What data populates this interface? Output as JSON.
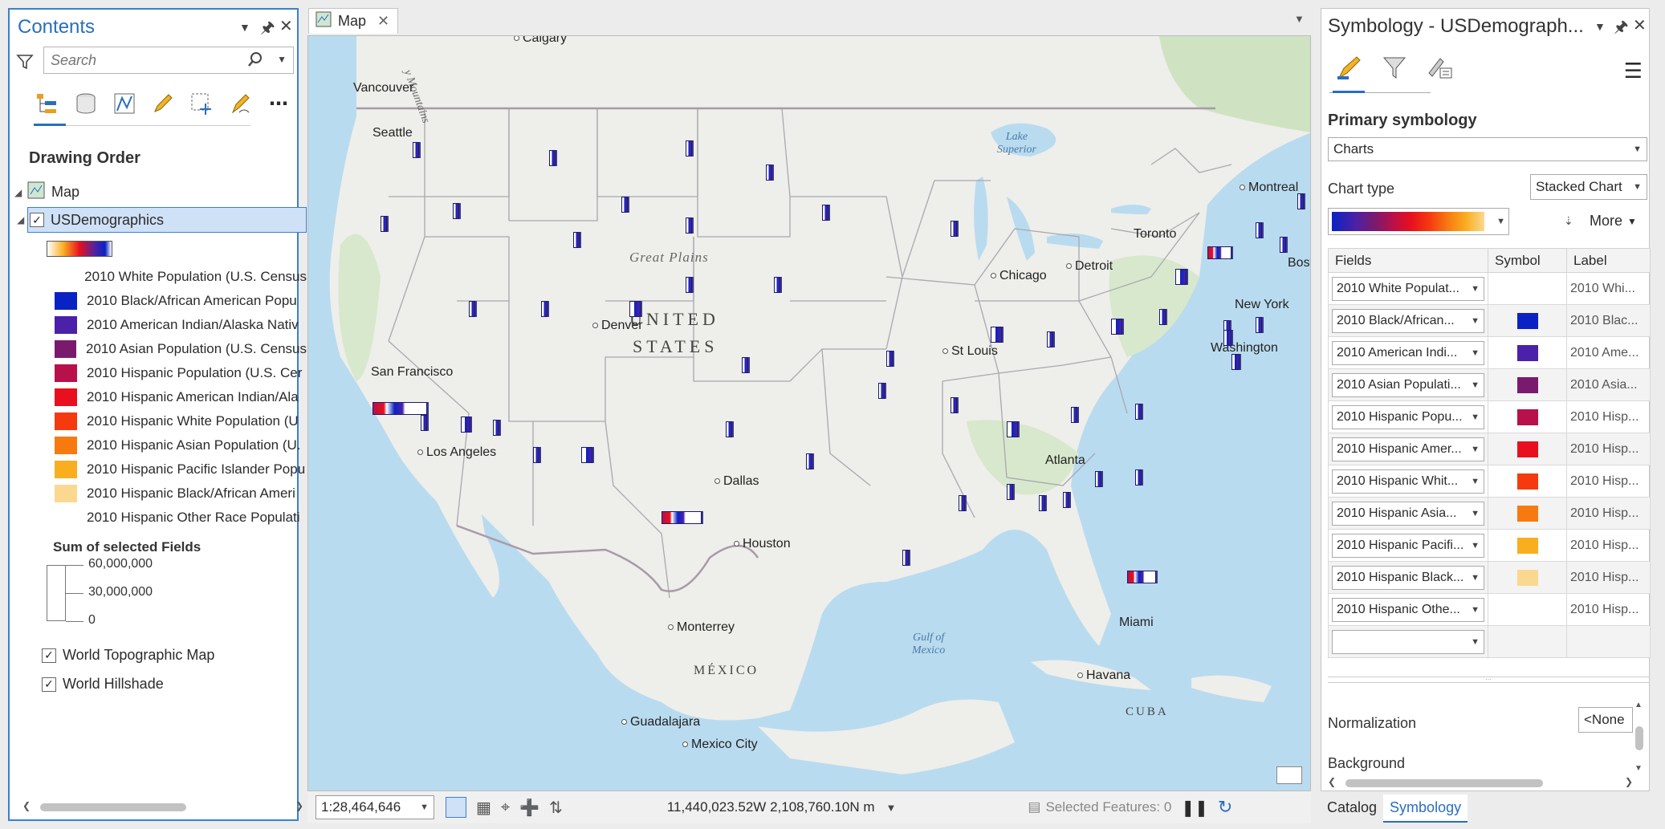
{
  "contents": {
    "title": "Contents",
    "search_placeholder": "Search",
    "drawing_order": "Drawing Order",
    "map_node": "Map",
    "layer_name": "USDemographics",
    "legend": [
      {
        "label": "2010 White Population (U.S. Census",
        "color": "#ffffff"
      },
      {
        "label": "2010 Black/African American Popu",
        "color": "#0a22c4"
      },
      {
        "label": "2010 American Indian/Alaska Nativ",
        "color": "#4a21a8"
      },
      {
        "label": "2010 Asian Population (U.S. Census",
        "color": "#7a1a6e"
      },
      {
        "label": "2010 Hispanic Population (U.S. Cer",
        "color": "#b8104a"
      },
      {
        "label": "2010 Hispanic American Indian/Ala",
        "color": "#e8101e"
      },
      {
        "label": "2010 Hispanic White Population (U",
        "color": "#f53a10"
      },
      {
        "label": "2010 Hispanic Asian Population (U.",
        "color": "#f77a10"
      },
      {
        "label": "2010 Hispanic Pacific Islander Popu",
        "color": "#f9ae20"
      },
      {
        "label": "2010 Hispanic Black/African Ameri",
        "color": "#fbd890"
      },
      {
        "label": "2010 Hispanic Other Race Populati",
        "color": "#ffffff"
      }
    ],
    "sum_title": "Sum of selected Fields",
    "sum_values": [
      "60,000,000",
      "30,000,000",
      "0"
    ],
    "basemaps": [
      "World Topographic Map",
      "World Hillshade"
    ]
  },
  "map": {
    "tab_label": "Map",
    "cities": [
      {
        "name": "Calgary"
      },
      {
        "name": "Vancouver"
      },
      {
        "name": "Seattle"
      },
      {
        "name": "San Francisco"
      },
      {
        "name": "Los Angeles"
      },
      {
        "name": "Denver"
      },
      {
        "name": "Dallas"
      },
      {
        "name": "Houston"
      },
      {
        "name": "Monterrey"
      },
      {
        "name": "Guadalajara"
      },
      {
        "name": "Mexico City"
      },
      {
        "name": "Chicago"
      },
      {
        "name": "St Louis"
      },
      {
        "name": "Detroit"
      },
      {
        "name": "Toronto"
      },
      {
        "name": "Montreal"
      },
      {
        "name": "New York"
      },
      {
        "name": "Washington"
      },
      {
        "name": "Atlanta"
      },
      {
        "name": "Miami"
      },
      {
        "name": "Havana"
      },
      {
        "name": "Bost"
      }
    ],
    "country_label_1": "UNITED",
    "country_label_2": "STATES",
    "mexico_label": "MÉXICO",
    "cuba_label": "CUBA",
    "great_plains": "Great Plains",
    "lake_superior": "Lake\nSuperior",
    "gulf": "Gulf of\nMexico",
    "mountains": "y Mountains",
    "scale": "1:28,464,646",
    "coordinates": "11,440,023.52W 2,108,760.10N m",
    "selected_features": "Selected Features: 0"
  },
  "symbology": {
    "title": "Symbology - USDemograph...",
    "primary": "Primary symbology",
    "renderer": "Charts",
    "chart_type_label": "Chart type",
    "chart_type": "Stacked Chart",
    "more": "More",
    "col_fields": "Fields",
    "col_symbol": "Symbol",
    "col_label": "Label",
    "rows": [
      {
        "field": "2010 White Populat...",
        "color": "",
        "label": "2010 Whi..."
      },
      {
        "field": "2010   Black/African...",
        "color": "#0a22c4",
        "label": "2010 Blac..."
      },
      {
        "field": "2010  American  Indi...",
        "color": "#4a21a8",
        "label": "2010 Ame..."
      },
      {
        "field": "2010 Asian Populati...",
        "color": "#7a1a6e",
        "label": "2010 Asia..."
      },
      {
        "field": "2010 Hispanic Popu...",
        "color": "#b8104a",
        "label": "2010 Hisp..."
      },
      {
        "field": "2010 Hispanic Amer...",
        "color": "#e8101e",
        "label": "2010 Hisp..."
      },
      {
        "field": "2010 Hispanic Whit...",
        "color": "#f53a10",
        "label": "2010 Hisp..."
      },
      {
        "field": "2010  Hispanic  Asia...",
        "color": "#f77a10",
        "label": "2010 Hisp..."
      },
      {
        "field": "2010 Hispanic Pacifi...",
        "color": "#f9ae20",
        "label": "2010 Hisp..."
      },
      {
        "field": "2010 Hispanic Black...",
        "color": "#fbd890",
        "label": "2010 Hisp..."
      },
      {
        "field": "2010 Hispanic Othe...",
        "color": "",
        "label": "2010 Hisp..."
      },
      {
        "field": "",
        "color": "",
        "label": ""
      }
    ],
    "normalization_label": "Normalization",
    "normalization_value": "<None",
    "background_label": "Background",
    "tab_catalog": "Catalog",
    "tab_symbology": "Symbology"
  }
}
